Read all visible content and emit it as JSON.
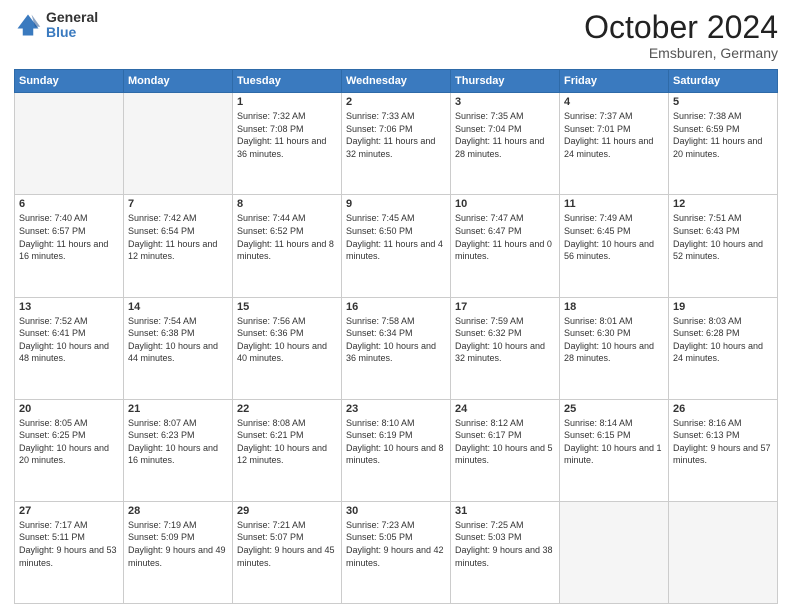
{
  "header": {
    "logo_general": "General",
    "logo_blue": "Blue",
    "month": "October 2024",
    "location": "Emsburen, Germany"
  },
  "days_of_week": [
    "Sunday",
    "Monday",
    "Tuesday",
    "Wednesday",
    "Thursday",
    "Friday",
    "Saturday"
  ],
  "weeks": [
    [
      {
        "day": "",
        "info": ""
      },
      {
        "day": "",
        "info": ""
      },
      {
        "day": "1",
        "info": "Sunrise: 7:32 AM\nSunset: 7:08 PM\nDaylight: 11 hours and 36 minutes."
      },
      {
        "day": "2",
        "info": "Sunrise: 7:33 AM\nSunset: 7:06 PM\nDaylight: 11 hours and 32 minutes."
      },
      {
        "day": "3",
        "info": "Sunrise: 7:35 AM\nSunset: 7:04 PM\nDaylight: 11 hours and 28 minutes."
      },
      {
        "day": "4",
        "info": "Sunrise: 7:37 AM\nSunset: 7:01 PM\nDaylight: 11 hours and 24 minutes."
      },
      {
        "day": "5",
        "info": "Sunrise: 7:38 AM\nSunset: 6:59 PM\nDaylight: 11 hours and 20 minutes."
      }
    ],
    [
      {
        "day": "6",
        "info": "Sunrise: 7:40 AM\nSunset: 6:57 PM\nDaylight: 11 hours and 16 minutes."
      },
      {
        "day": "7",
        "info": "Sunrise: 7:42 AM\nSunset: 6:54 PM\nDaylight: 11 hours and 12 minutes."
      },
      {
        "day": "8",
        "info": "Sunrise: 7:44 AM\nSunset: 6:52 PM\nDaylight: 11 hours and 8 minutes."
      },
      {
        "day": "9",
        "info": "Sunrise: 7:45 AM\nSunset: 6:50 PM\nDaylight: 11 hours and 4 minutes."
      },
      {
        "day": "10",
        "info": "Sunrise: 7:47 AM\nSunset: 6:47 PM\nDaylight: 11 hours and 0 minutes."
      },
      {
        "day": "11",
        "info": "Sunrise: 7:49 AM\nSunset: 6:45 PM\nDaylight: 10 hours and 56 minutes."
      },
      {
        "day": "12",
        "info": "Sunrise: 7:51 AM\nSunset: 6:43 PM\nDaylight: 10 hours and 52 minutes."
      }
    ],
    [
      {
        "day": "13",
        "info": "Sunrise: 7:52 AM\nSunset: 6:41 PM\nDaylight: 10 hours and 48 minutes."
      },
      {
        "day": "14",
        "info": "Sunrise: 7:54 AM\nSunset: 6:38 PM\nDaylight: 10 hours and 44 minutes."
      },
      {
        "day": "15",
        "info": "Sunrise: 7:56 AM\nSunset: 6:36 PM\nDaylight: 10 hours and 40 minutes."
      },
      {
        "day": "16",
        "info": "Sunrise: 7:58 AM\nSunset: 6:34 PM\nDaylight: 10 hours and 36 minutes."
      },
      {
        "day": "17",
        "info": "Sunrise: 7:59 AM\nSunset: 6:32 PM\nDaylight: 10 hours and 32 minutes."
      },
      {
        "day": "18",
        "info": "Sunrise: 8:01 AM\nSunset: 6:30 PM\nDaylight: 10 hours and 28 minutes."
      },
      {
        "day": "19",
        "info": "Sunrise: 8:03 AM\nSunset: 6:28 PM\nDaylight: 10 hours and 24 minutes."
      }
    ],
    [
      {
        "day": "20",
        "info": "Sunrise: 8:05 AM\nSunset: 6:25 PM\nDaylight: 10 hours and 20 minutes."
      },
      {
        "day": "21",
        "info": "Sunrise: 8:07 AM\nSunset: 6:23 PM\nDaylight: 10 hours and 16 minutes."
      },
      {
        "day": "22",
        "info": "Sunrise: 8:08 AM\nSunset: 6:21 PM\nDaylight: 10 hours and 12 minutes."
      },
      {
        "day": "23",
        "info": "Sunrise: 8:10 AM\nSunset: 6:19 PM\nDaylight: 10 hours and 8 minutes."
      },
      {
        "day": "24",
        "info": "Sunrise: 8:12 AM\nSunset: 6:17 PM\nDaylight: 10 hours and 5 minutes."
      },
      {
        "day": "25",
        "info": "Sunrise: 8:14 AM\nSunset: 6:15 PM\nDaylight: 10 hours and 1 minute."
      },
      {
        "day": "26",
        "info": "Sunrise: 8:16 AM\nSunset: 6:13 PM\nDaylight: 9 hours and 57 minutes."
      }
    ],
    [
      {
        "day": "27",
        "info": "Sunrise: 7:17 AM\nSunset: 5:11 PM\nDaylight: 9 hours and 53 minutes."
      },
      {
        "day": "28",
        "info": "Sunrise: 7:19 AM\nSunset: 5:09 PM\nDaylight: 9 hours and 49 minutes."
      },
      {
        "day": "29",
        "info": "Sunrise: 7:21 AM\nSunset: 5:07 PM\nDaylight: 9 hours and 45 minutes."
      },
      {
        "day": "30",
        "info": "Sunrise: 7:23 AM\nSunset: 5:05 PM\nDaylight: 9 hours and 42 minutes."
      },
      {
        "day": "31",
        "info": "Sunrise: 7:25 AM\nSunset: 5:03 PM\nDaylight: 9 hours and 38 minutes."
      },
      {
        "day": "",
        "info": ""
      },
      {
        "day": "",
        "info": ""
      }
    ]
  ]
}
